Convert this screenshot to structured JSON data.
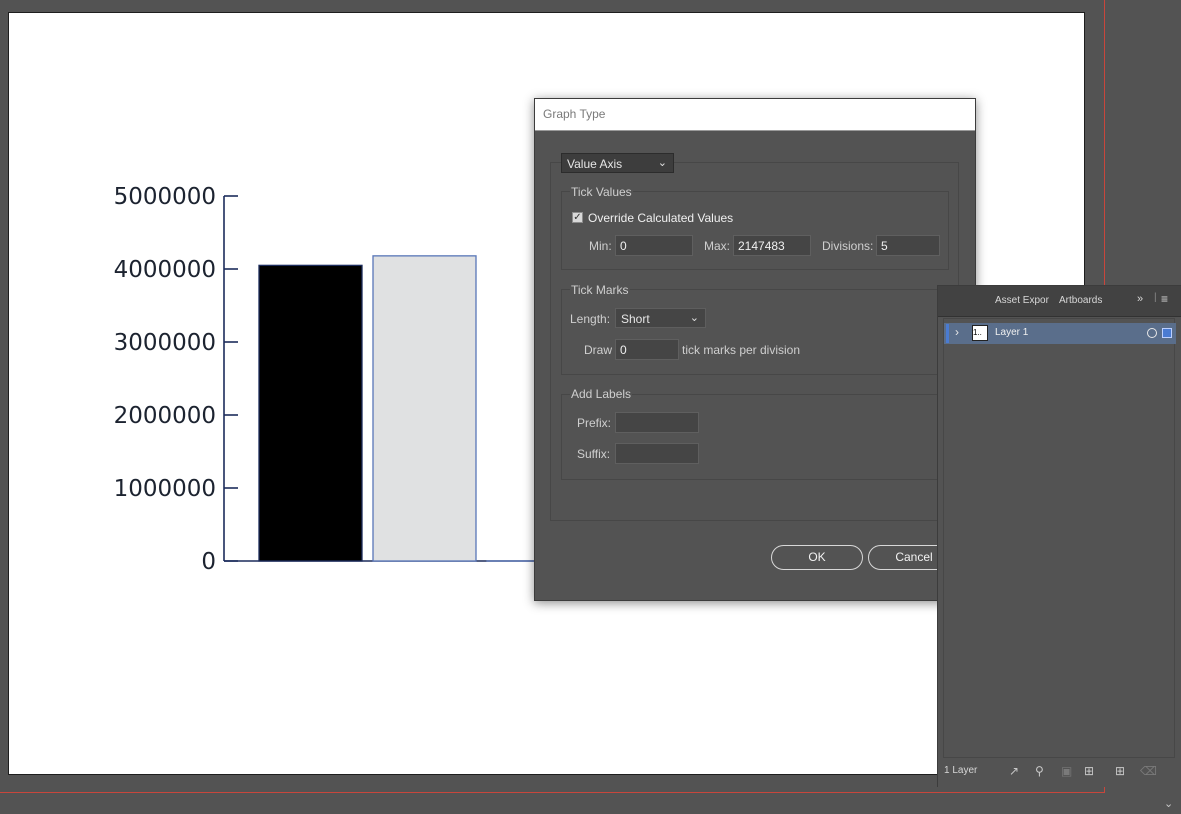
{
  "chart_data": {
    "type": "bar",
    "categories": [
      "",
      "",
      ""
    ],
    "values": [
      4050000,
      4180000,
      0
    ],
    "bar_colors": [
      "#000000",
      "#e0e1e2",
      "#ffffff"
    ],
    "y_tick_labels": [
      "0",
      "1000000",
      "2000000",
      "3000000",
      "4000000",
      "5000000"
    ],
    "ylim": [
      0,
      5000000
    ],
    "axis_color": "#1c2c5c",
    "title": "",
    "xlabel": "",
    "ylabel": ""
  },
  "dialog": {
    "title": "Graph Type",
    "axis_select": "Value Axis",
    "tick_values": {
      "title": "Tick Values",
      "override_label": "Override Calculated Values",
      "override_checked": true,
      "min_label": "Min:",
      "min_value": "0",
      "max_label": "Max:",
      "max_value": "2147483",
      "divisions_label": "Divisions:",
      "divisions_value": "5"
    },
    "tick_marks": {
      "title": "Tick Marks",
      "length_label": "Length:",
      "length_value": "Short",
      "draw_label": "Draw",
      "draw_value": "0",
      "per_division": "tick marks per division"
    },
    "add_labels": {
      "title": "Add Labels",
      "prefix_label": "Prefix:",
      "prefix_value": "",
      "suffix_label": "Suffix:",
      "suffix_value": ""
    },
    "ok_label": "OK",
    "cancel_label": "Cancel"
  },
  "layers_panel": {
    "tabs": [
      "Asset Expor",
      "Artboards"
    ],
    "layer_name": "Layer 1",
    "thumb_text": "1..",
    "footer_count": "1 Layer",
    "colors": {
      "selected_row": "#5a6e8b",
      "layer_color": "#4a7bd2"
    }
  }
}
